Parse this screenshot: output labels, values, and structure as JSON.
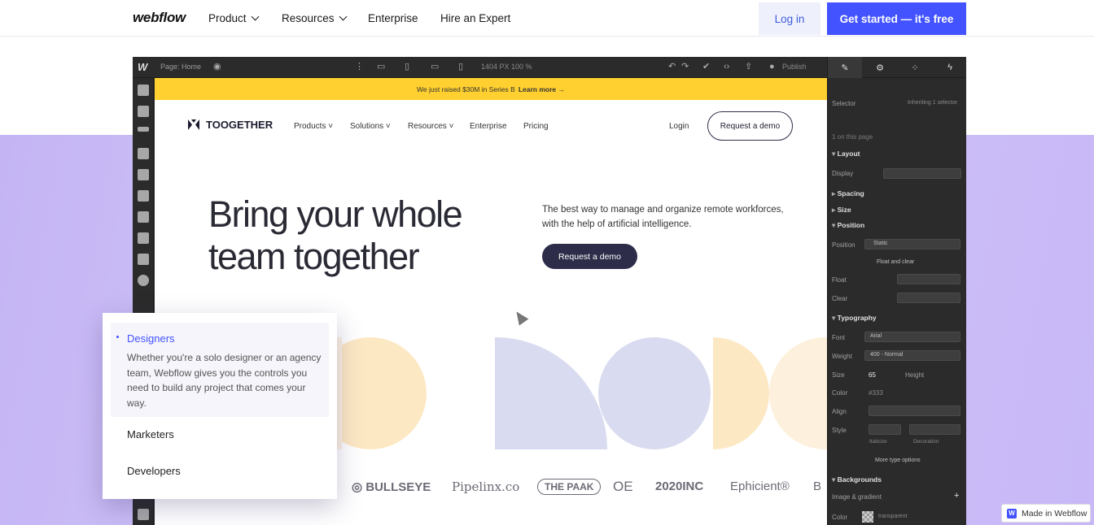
{
  "topnav": {
    "logo": "webflow",
    "links": [
      {
        "label": "Product",
        "dropdown": true
      },
      {
        "label": "Resources",
        "dropdown": true
      },
      {
        "label": "Enterprise",
        "dropdown": false
      },
      {
        "label": "Hire an Expert",
        "dropdown": false
      }
    ],
    "login": "Log in",
    "cta": "Get started — it's free"
  },
  "designer": {
    "logo": "W",
    "page_label": "Page: Home",
    "size_label": "1404 PX 100 %",
    "publish_label": "Publish",
    "canvas": {
      "banner_text": "We just raised $30M in Series B",
      "banner_link": "Learn more →",
      "brand": "TOOGETHER",
      "nav": [
        "Products ˅",
        "Solutions ˅",
        "Resources ˅",
        "Enterprise",
        "Pricing"
      ],
      "login": "Login",
      "demo_outline": "Request a demo",
      "hero_title": "Bring your whole team together",
      "hero_sub": "The best way to manage and organize remote workforces, with the help of artificial intelligence.",
      "hero_button": "Request a demo",
      "logos": [
        "◎ BULLSEYE",
        "Pipelinx.co",
        "THE PAAK",
        "OE",
        "2020INC",
        "Ephicient®",
        "B"
      ]
    },
    "panel": {
      "selector_label": "Selector",
      "selector_value": "Inheriting 1 selector",
      "on_page": "1 on this page",
      "layout": "Layout",
      "display": "Display",
      "spacing": "Spacing",
      "size": "Size",
      "position": "Position",
      "position_label": "Position",
      "position_value": "Static",
      "float_clear": "Float and clear",
      "float": "Float",
      "clear": "Clear",
      "typography": "Typography",
      "font_label": "Font",
      "font_value": "Arial",
      "weight_label": "Weight",
      "weight_value": "400 - Normal",
      "size_label": "Size",
      "size_value": "65",
      "height_label": "Height",
      "color_label": "Color",
      "color_value": "#333",
      "align_label": "Align",
      "style_label": "Style",
      "italicize": "Italicize",
      "decoration": "Decoration",
      "more_type": "More type options",
      "backgrounds": "Backgrounds",
      "image_gradient": "Image & gradient",
      "bg_color_label": "Color",
      "bg_color_value": "transparent"
    }
  },
  "popup": {
    "active_title": "Designers",
    "active_desc": "Whether you're a solo designer or an agency team, Webflow gives you the controls you need to build any project that comes your way.",
    "items": [
      "Marketers",
      "Developers"
    ]
  },
  "badge": {
    "text": "Made in Webflow"
  },
  "colors": {
    "accent": "#4353ff",
    "purple": "#c4b4f4",
    "banner": "#ffd02f",
    "dark": "#2b2b2b"
  }
}
